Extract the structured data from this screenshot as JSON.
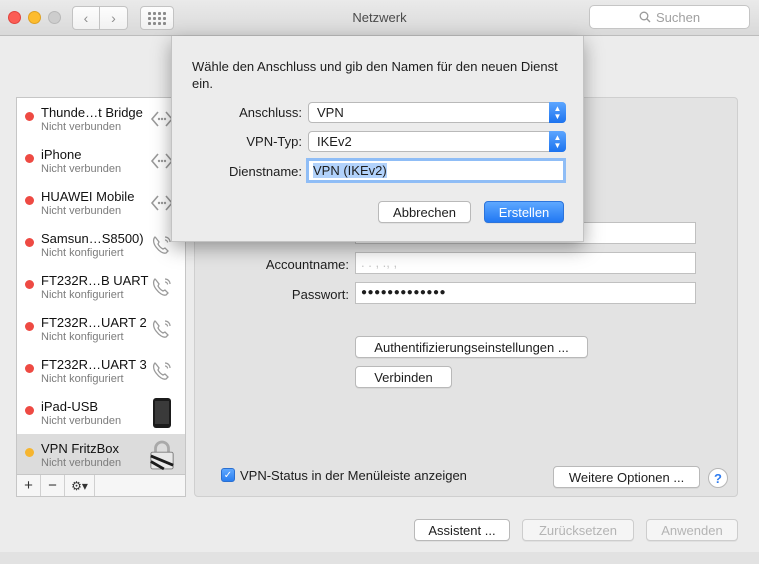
{
  "window": {
    "title": "Netzwerk",
    "search_placeholder": "Suchen",
    "nav_back": "‹",
    "nav_forward": "›"
  },
  "colors": {
    "status_red": "#ee4a43",
    "status_yellow": "#f6b52f",
    "accent_blue": "#2178f3"
  },
  "services": [
    {
      "name": "Thunde…t Bridge",
      "status": "Nicht verbunden",
      "dot": "red",
      "icon": "thunderbolt-bridge-icon"
    },
    {
      "name": "iPhone",
      "status": "Nicht verbunden",
      "dot": "red",
      "icon": "thunderbolt-bridge-icon"
    },
    {
      "name": "HUAWEI Mobile",
      "status": "Nicht verbunden",
      "dot": "red",
      "icon": "thunderbolt-bridge-icon"
    },
    {
      "name": "Samsun…S8500)",
      "status": "Nicht konfiguriert",
      "dot": "red",
      "icon": "phone-icon"
    },
    {
      "name": "FT232R…B UART",
      "status": "Nicht konfiguriert",
      "dot": "red",
      "icon": "phone-icon"
    },
    {
      "name": "FT232R…UART 2",
      "status": "Nicht konfiguriert",
      "dot": "red",
      "icon": "phone-icon"
    },
    {
      "name": "FT232R…UART 3",
      "status": "Nicht konfiguriert",
      "dot": "red",
      "icon": "phone-icon"
    },
    {
      "name": "iPad-USB",
      "status": "Nicht verbunden",
      "dot": "red",
      "icon": "ipad-icon"
    },
    {
      "name": "VPN FritzBox",
      "status": "Nicht verbunden",
      "dot": "yellow",
      "icon": "vpn-lock-icon",
      "selected": true
    }
  ],
  "sidebar_toolbar": {
    "add": "+",
    "remove": "−",
    "gear": "⚙▾"
  },
  "form": {
    "account_label": "Accountname:",
    "account_value": ".  . ,  ., ,",
    "password_label": "Passwort:",
    "password_value": "●●●●●●●●●●●●●",
    "auth_button": "Authentifizierungseinstellungen ...",
    "connect_button": "Verbinden",
    "menu_status_label": "VPN-Status in der Menüleiste anzeigen",
    "menu_status_checked": "✓",
    "advanced_button": "Weitere Optionen ...",
    "help": "?"
  },
  "footer": {
    "assistant": "Assistent ...",
    "revert": "Zurücksetzen",
    "apply": "Anwenden"
  },
  "sheet": {
    "message": "Wähle den Anschluss und gib den Namen für den neuen Dienst ein.",
    "interface_label": "Anschluss:",
    "interface_value": "VPN",
    "vpn_type_label": "VPN-Typ:",
    "vpn_type_value": "IKEv2",
    "service_name_label": "Dienstname:",
    "service_name_value": "VPN (IKEv2)",
    "cancel": "Abbrechen",
    "create": "Erstellen"
  }
}
